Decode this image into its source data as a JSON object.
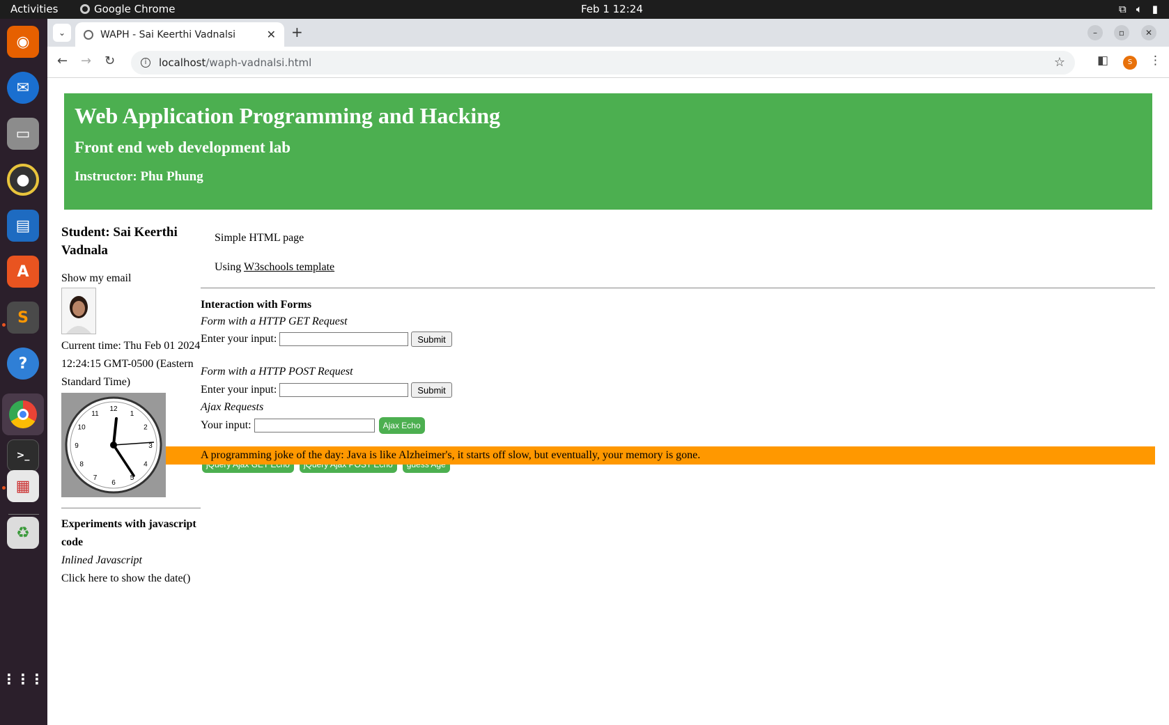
{
  "system": {
    "activities": "Activities",
    "app_name": "Google Chrome",
    "datetime": "Feb 1  12:24"
  },
  "browser": {
    "tab_title": "WAPH - Sai Keerthi Vadnalsi",
    "url_host": "localhost",
    "url_path": "/waph-vadnalsi.html",
    "profile_initial": "S"
  },
  "header": {
    "title": "Web Application Programming and Hacking",
    "subtitle": "Front end web development lab",
    "instructor": "Instructor: Phu Phung"
  },
  "left": {
    "student": "Student: Sai Keerthi Vadnala",
    "show_email": "Show my email",
    "current_time": "Current time: Thu Feb 01 2024 12:24:15 GMT-0500 (Eastern Standard Time)",
    "clock_numbers": [
      "12",
      "1",
      "2",
      "3",
      "4",
      "5",
      "6",
      "7",
      "8",
      "9",
      "10",
      "11"
    ],
    "js_heading": "Experiments with javascript code",
    "inlined": "Inlined Javascript",
    "click_date": "Click here to show the date()"
  },
  "main": {
    "simple": "Simple HTML page",
    "using": "Using ",
    "w3_link": "W3schools template",
    "forms_heading": "Interaction with Forms",
    "get_heading": "Form with a HTTP GET Request",
    "input_label": "Enter your input:",
    "submit": "Submit",
    "post_heading": "Form with a HTTP POST Request",
    "ajax_heading": "Ajax Requests",
    "your_input": "Your input:",
    "ajax_echo": "Ajax Echo",
    "joke": "A programming joke of the day: Java is like Alzheimer's, it starts off slow, but eventually, your memory is gone.",
    "jq_get": "jQuery Ajax GET Echo",
    "jq_post": "jQuery Ajax POST Echo",
    "guess_age": "guess Age"
  }
}
